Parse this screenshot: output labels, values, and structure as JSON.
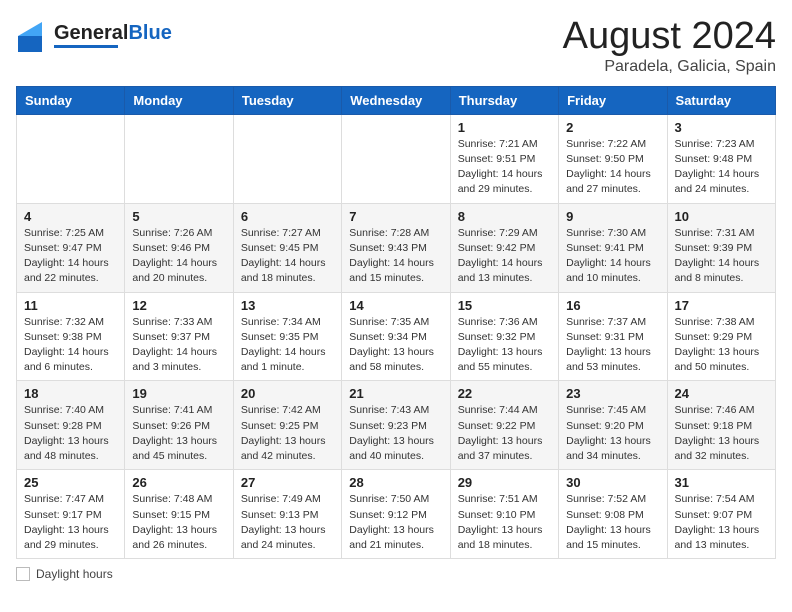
{
  "header": {
    "logo_general": "General",
    "logo_blue": "Blue",
    "month_year": "August 2024",
    "location": "Paradela, Galicia, Spain"
  },
  "days_of_week": [
    "Sunday",
    "Monday",
    "Tuesday",
    "Wednesday",
    "Thursday",
    "Friday",
    "Saturday"
  ],
  "footer": {
    "label": "Daylight hours"
  },
  "weeks": [
    {
      "days": [
        {
          "num": "",
          "info": ""
        },
        {
          "num": "",
          "info": ""
        },
        {
          "num": "",
          "info": ""
        },
        {
          "num": "",
          "info": ""
        },
        {
          "num": "1",
          "info": "Sunrise: 7:21 AM\nSunset: 9:51 PM\nDaylight: 14 hours\nand 29 minutes."
        },
        {
          "num": "2",
          "info": "Sunrise: 7:22 AM\nSunset: 9:50 PM\nDaylight: 14 hours\nand 27 minutes."
        },
        {
          "num": "3",
          "info": "Sunrise: 7:23 AM\nSunset: 9:48 PM\nDaylight: 14 hours\nand 24 minutes."
        }
      ]
    },
    {
      "days": [
        {
          "num": "4",
          "info": "Sunrise: 7:25 AM\nSunset: 9:47 PM\nDaylight: 14 hours\nand 22 minutes."
        },
        {
          "num": "5",
          "info": "Sunrise: 7:26 AM\nSunset: 9:46 PM\nDaylight: 14 hours\nand 20 minutes."
        },
        {
          "num": "6",
          "info": "Sunrise: 7:27 AM\nSunset: 9:45 PM\nDaylight: 14 hours\nand 18 minutes."
        },
        {
          "num": "7",
          "info": "Sunrise: 7:28 AM\nSunset: 9:43 PM\nDaylight: 14 hours\nand 15 minutes."
        },
        {
          "num": "8",
          "info": "Sunrise: 7:29 AM\nSunset: 9:42 PM\nDaylight: 14 hours\nand 13 minutes."
        },
        {
          "num": "9",
          "info": "Sunrise: 7:30 AM\nSunset: 9:41 PM\nDaylight: 14 hours\nand 10 minutes."
        },
        {
          "num": "10",
          "info": "Sunrise: 7:31 AM\nSunset: 9:39 PM\nDaylight: 14 hours\nand 8 minutes."
        }
      ]
    },
    {
      "days": [
        {
          "num": "11",
          "info": "Sunrise: 7:32 AM\nSunset: 9:38 PM\nDaylight: 14 hours\nand 6 minutes."
        },
        {
          "num": "12",
          "info": "Sunrise: 7:33 AM\nSunset: 9:37 PM\nDaylight: 14 hours\nand 3 minutes."
        },
        {
          "num": "13",
          "info": "Sunrise: 7:34 AM\nSunset: 9:35 PM\nDaylight: 14 hours\nand 1 minute."
        },
        {
          "num": "14",
          "info": "Sunrise: 7:35 AM\nSunset: 9:34 PM\nDaylight: 13 hours\nand 58 minutes."
        },
        {
          "num": "15",
          "info": "Sunrise: 7:36 AM\nSunset: 9:32 PM\nDaylight: 13 hours\nand 55 minutes."
        },
        {
          "num": "16",
          "info": "Sunrise: 7:37 AM\nSunset: 9:31 PM\nDaylight: 13 hours\nand 53 minutes."
        },
        {
          "num": "17",
          "info": "Sunrise: 7:38 AM\nSunset: 9:29 PM\nDaylight: 13 hours\nand 50 minutes."
        }
      ]
    },
    {
      "days": [
        {
          "num": "18",
          "info": "Sunrise: 7:40 AM\nSunset: 9:28 PM\nDaylight: 13 hours\nand 48 minutes."
        },
        {
          "num": "19",
          "info": "Sunrise: 7:41 AM\nSunset: 9:26 PM\nDaylight: 13 hours\nand 45 minutes."
        },
        {
          "num": "20",
          "info": "Sunrise: 7:42 AM\nSunset: 9:25 PM\nDaylight: 13 hours\nand 42 minutes."
        },
        {
          "num": "21",
          "info": "Sunrise: 7:43 AM\nSunset: 9:23 PM\nDaylight: 13 hours\nand 40 minutes."
        },
        {
          "num": "22",
          "info": "Sunrise: 7:44 AM\nSunset: 9:22 PM\nDaylight: 13 hours\nand 37 minutes."
        },
        {
          "num": "23",
          "info": "Sunrise: 7:45 AM\nSunset: 9:20 PM\nDaylight: 13 hours\nand 34 minutes."
        },
        {
          "num": "24",
          "info": "Sunrise: 7:46 AM\nSunset: 9:18 PM\nDaylight: 13 hours\nand 32 minutes."
        }
      ]
    },
    {
      "days": [
        {
          "num": "25",
          "info": "Sunrise: 7:47 AM\nSunset: 9:17 PM\nDaylight: 13 hours\nand 29 minutes."
        },
        {
          "num": "26",
          "info": "Sunrise: 7:48 AM\nSunset: 9:15 PM\nDaylight: 13 hours\nand 26 minutes."
        },
        {
          "num": "27",
          "info": "Sunrise: 7:49 AM\nSunset: 9:13 PM\nDaylight: 13 hours\nand 24 minutes."
        },
        {
          "num": "28",
          "info": "Sunrise: 7:50 AM\nSunset: 9:12 PM\nDaylight: 13 hours\nand 21 minutes."
        },
        {
          "num": "29",
          "info": "Sunrise: 7:51 AM\nSunset: 9:10 PM\nDaylight: 13 hours\nand 18 minutes."
        },
        {
          "num": "30",
          "info": "Sunrise: 7:52 AM\nSunset: 9:08 PM\nDaylight: 13 hours\nand 15 minutes."
        },
        {
          "num": "31",
          "info": "Sunrise: 7:54 AM\nSunset: 9:07 PM\nDaylight: 13 hours\nand 13 minutes."
        }
      ]
    }
  ]
}
